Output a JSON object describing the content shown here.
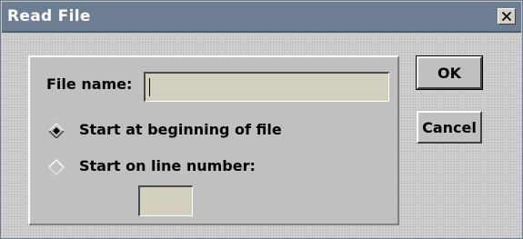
{
  "window": {
    "title": "Read File",
    "close_glyph": "✕"
  },
  "form": {
    "file_name_label": "File name:",
    "file_name_value": "",
    "start_options": [
      {
        "label": "Start at beginning of file",
        "selected": true
      },
      {
        "label": "Start on line number:",
        "selected": false
      }
    ],
    "line_number_value": ""
  },
  "buttons": {
    "ok_label": "OK",
    "cancel_label": "Cancel"
  },
  "colors": {
    "titlebar": "#6e7e92",
    "dialog_face": "#c0c0c0",
    "field_bg": "#d4d0c0"
  }
}
